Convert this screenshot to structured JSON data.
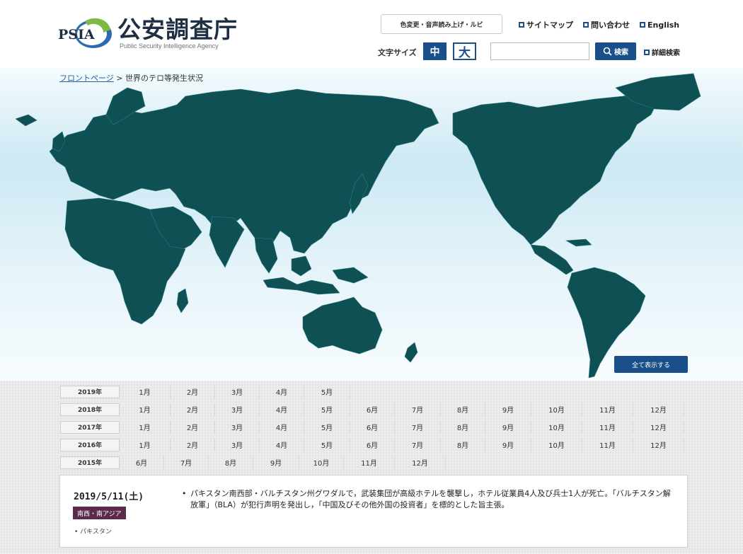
{
  "header": {
    "logo_mark": "PSIA",
    "logo_title": "公安調査庁",
    "logo_subtitle": "Public Security Intelligence Agency",
    "ruby_button": "色変更・音声読み上げ・ルビ",
    "links": [
      "サイトマップ",
      "問い合わせ",
      "English"
    ],
    "font_size_label": "文字サイズ",
    "font_size_mid": "中",
    "font_size_large": "大",
    "search_value": "",
    "search_button": "検索",
    "advanced_search": "詳細検索"
  },
  "breadcrumb": {
    "home": "フロントページ",
    "separator": ">",
    "current": "世界のテロ等発生状況"
  },
  "map": {
    "show_all_button": "全て表示する",
    "land_color": "#0f5054",
    "ocean_color": "#cde9f3"
  },
  "calendar": [
    {
      "year": "2019年",
      "months": [
        "1月",
        "2月",
        "3月",
        "4月",
        "5月"
      ]
    },
    {
      "year": "2018年",
      "months": [
        "1月",
        "2月",
        "3月",
        "4月",
        "5月",
        "6月",
        "7月",
        "8月",
        "9月",
        "10月",
        "11月",
        "12月"
      ]
    },
    {
      "year": "2017年",
      "months": [
        "1月",
        "2月",
        "3月",
        "4月",
        "5月",
        "6月",
        "7月",
        "8月",
        "9月",
        "10月",
        "11月",
        "12月"
      ]
    },
    {
      "year": "2016年",
      "months": [
        "1月",
        "2月",
        "3月",
        "4月",
        "5月",
        "6月",
        "7月",
        "8月",
        "9月",
        "10月",
        "11月",
        "12月"
      ]
    },
    {
      "year": "2015年",
      "months": [
        "6月",
        "7月",
        "8月",
        "9月",
        "10月",
        "11月",
        "12月"
      ]
    }
  ],
  "event": {
    "date": "2019/5/11(土)",
    "region": "南西・南アジア",
    "country": "パキスタン",
    "text": "パキスタン南西部・バルチスタン州グワダルで，武装集団が高級ホテルを襲撃し，ホテル従業員4人及び兵士1人が死亡。「バルチスタン解放軍」（BLA）が犯行声明を発出し，「中国及びその他外国の投資者」を標的とした旨主張。"
  },
  "colors": {
    "brand_blue": "#1b4f8a",
    "region_badge": "#5b2a4e"
  }
}
